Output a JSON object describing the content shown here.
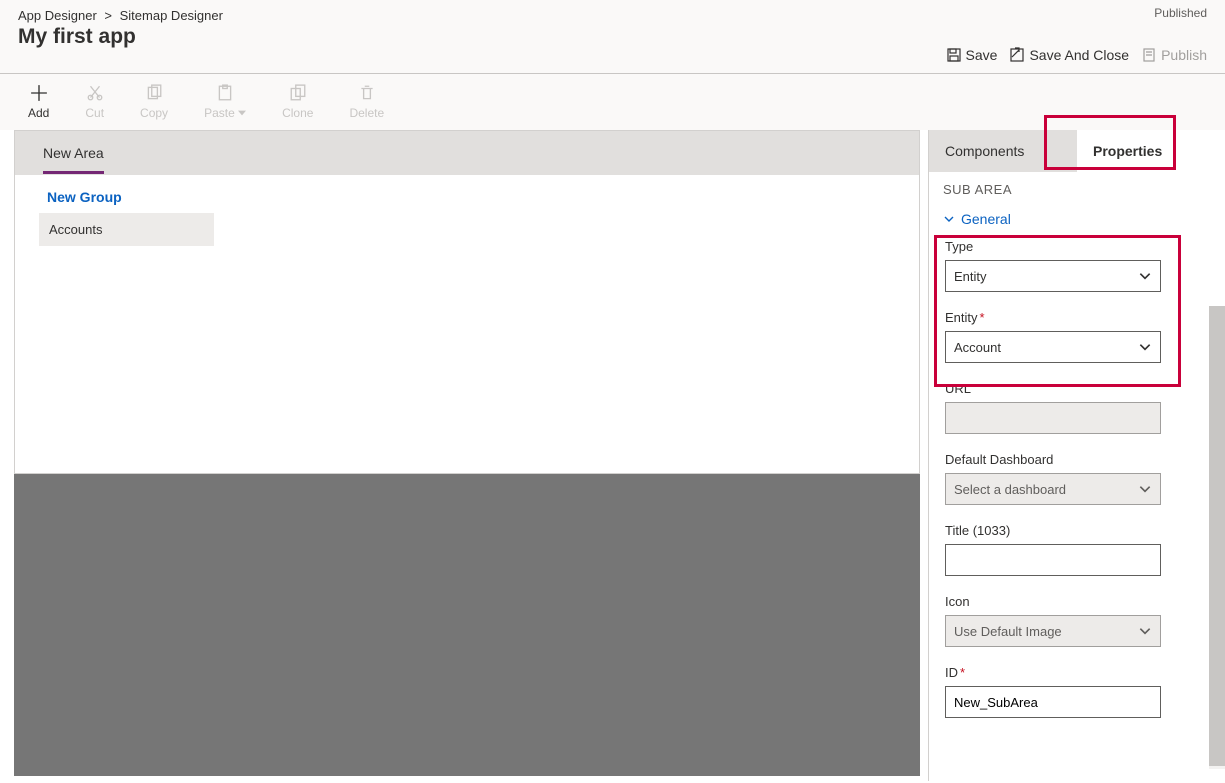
{
  "header": {
    "breadcrumb_root": "App Designer",
    "breadcrumb_current": "Sitemap Designer",
    "app_title": "My first app",
    "status": "Published",
    "actions": {
      "save": "Save",
      "save_and_close": "Save And Close",
      "publish": "Publish"
    }
  },
  "toolbar": {
    "add": "Add",
    "cut": "Cut",
    "copy": "Copy",
    "paste": "Paste",
    "clone": "Clone",
    "delete": "Delete"
  },
  "canvas": {
    "area": "New Area",
    "group": "New Group",
    "subarea": "Accounts"
  },
  "side": {
    "tab_components": "Components",
    "tab_properties": "Properties",
    "panel_title": "SUB AREA",
    "section_general": "General",
    "fields": {
      "type_label": "Type",
      "type_value": "Entity",
      "entity_label": "Entity",
      "entity_value": "Account",
      "url_label": "URL",
      "url_value": "",
      "dashboard_label": "Default Dashboard",
      "dashboard_placeholder": "Select a dashboard",
      "title_label": "Title (1033)",
      "title_value": "",
      "icon_label": "Icon",
      "icon_value": "Use Default Image",
      "id_label": "ID",
      "id_value": "New_SubArea"
    }
  }
}
